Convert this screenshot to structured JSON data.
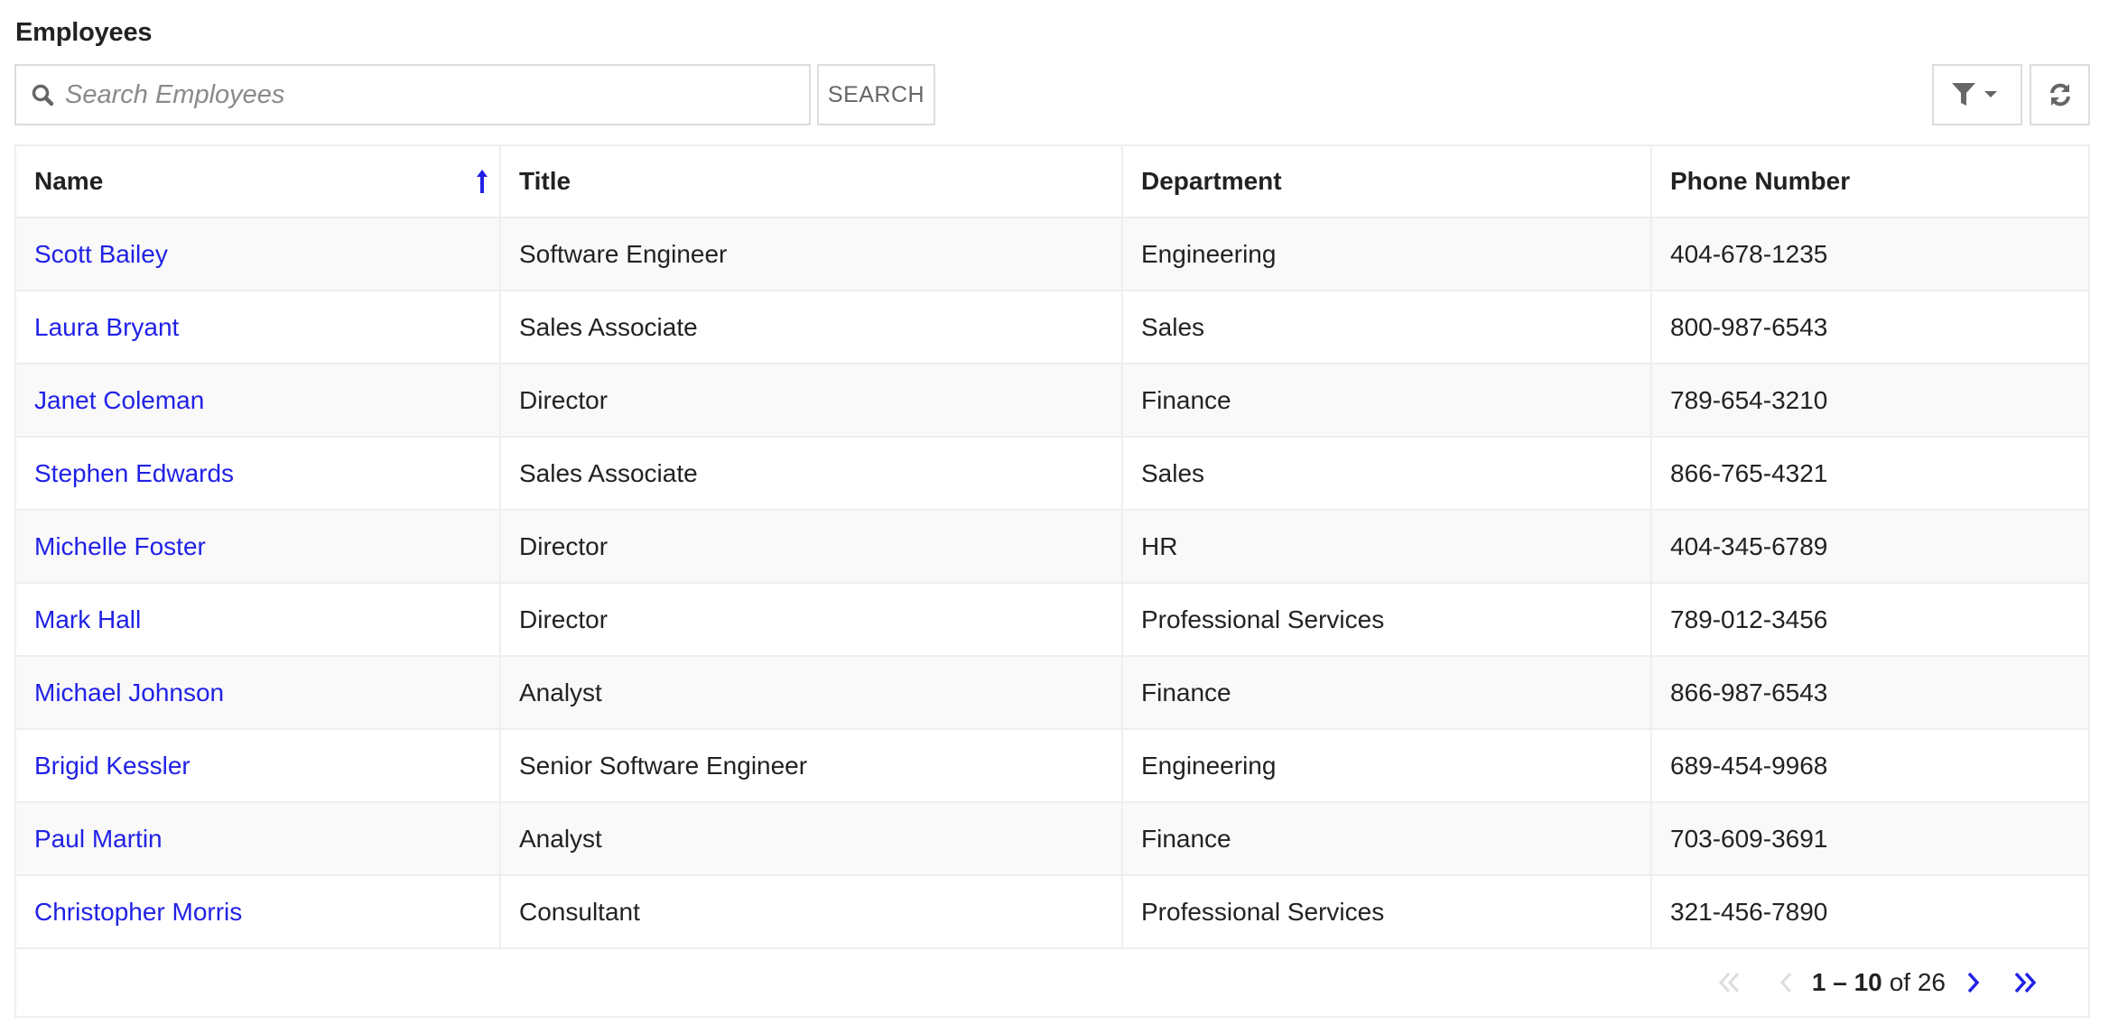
{
  "page": {
    "title": "Employees"
  },
  "toolbar": {
    "search_placeholder": "Search Employees",
    "search_value": "",
    "search_button_label": "SEARCH",
    "filter_icon": "filter-funnel-icon",
    "refresh_icon": "refresh-icon"
  },
  "colors": {
    "link": "#2121e6",
    "sort_indicator": "#2121e6",
    "pager_active": "#2121e6",
    "pager_disabled": "#dddddd",
    "border": "#eeeeee",
    "stripe": "#f9f9f9"
  },
  "table": {
    "columns": [
      {
        "key": "name",
        "label": "Name",
        "sorted": "ascending"
      },
      {
        "key": "title",
        "label": "Title"
      },
      {
        "key": "department",
        "label": "Department"
      },
      {
        "key": "phone",
        "label": "Phone Number"
      }
    ],
    "rows": [
      {
        "name": "Scott Bailey",
        "title": "Software Engineer",
        "department": "Engineering",
        "phone": "404-678-1235"
      },
      {
        "name": "Laura Bryant",
        "title": "Sales Associate",
        "department": "Sales",
        "phone": "800-987-6543"
      },
      {
        "name": "Janet Coleman",
        "title": "Director",
        "department": "Finance",
        "phone": "789-654-3210"
      },
      {
        "name": "Stephen Edwards",
        "title": "Sales Associate",
        "department": "Sales",
        "phone": "866-765-4321"
      },
      {
        "name": "Michelle Foster",
        "title": "Director",
        "department": "HR",
        "phone": "404-345-6789"
      },
      {
        "name": "Mark Hall",
        "title": "Director",
        "department": "Professional Services",
        "phone": "789-012-3456"
      },
      {
        "name": "Michael Johnson",
        "title": "Analyst",
        "department": "Finance",
        "phone": "866-987-6543"
      },
      {
        "name": "Brigid Kessler",
        "title": "Senior Software Engineer",
        "department": "Engineering",
        "phone": "689-454-9968"
      },
      {
        "name": "Paul Martin",
        "title": "Analyst",
        "department": "Finance",
        "phone": "703-609-3691"
      },
      {
        "name": "Christopher Morris",
        "title": "Consultant",
        "department": "Professional Services",
        "phone": "321-456-7890"
      }
    ]
  },
  "pagination": {
    "range": "1 – 10",
    "of_label": "of 26",
    "total": 26,
    "first_enabled": false,
    "prev_enabled": false,
    "next_enabled": true,
    "last_enabled": true
  }
}
